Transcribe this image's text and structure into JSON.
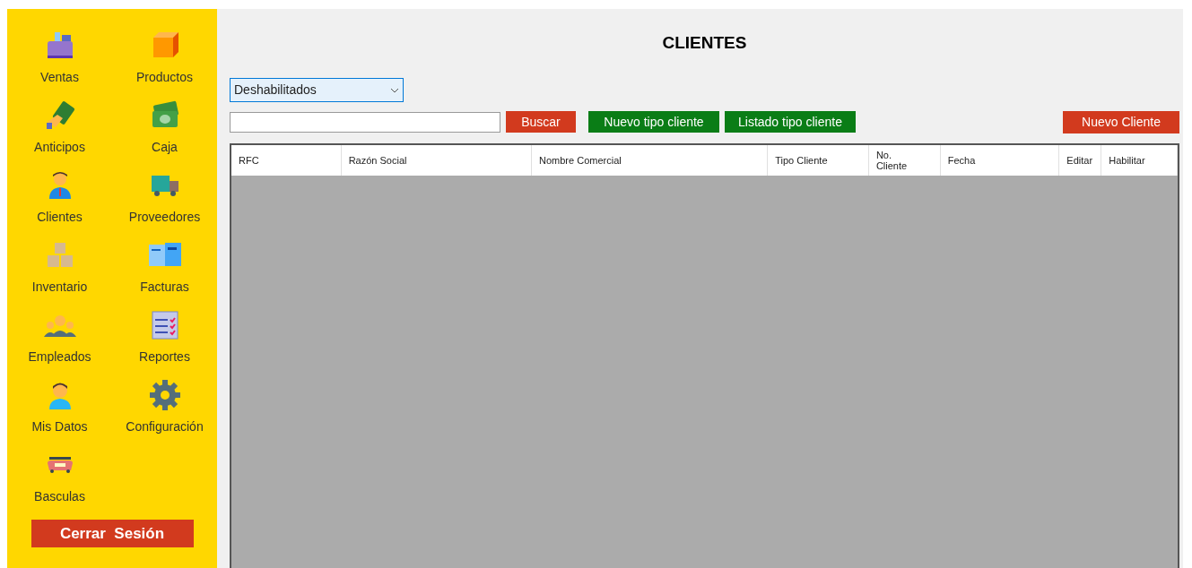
{
  "sidebar": {
    "items": [
      {
        "label": "Ventas"
      },
      {
        "label": "Productos"
      },
      {
        "label": "Anticipos"
      },
      {
        "label": "Caja"
      },
      {
        "label": "Clientes"
      },
      {
        "label": "Proveedores"
      },
      {
        "label": "Inventario"
      },
      {
        "label": "Facturas"
      },
      {
        "label": "Empleados"
      },
      {
        "label": "Reportes"
      },
      {
        "label": "Mis Datos"
      },
      {
        "label": "Configuración"
      },
      {
        "label": "Basculas"
      }
    ],
    "logout_button": "Cerrar  Sesión"
  },
  "title": "CLIENTES",
  "filter": {
    "value": "Deshabilitados"
  },
  "search": {
    "button": "Buscar"
  },
  "buttons": [
    {
      "label": "Nuevo tipo cliente"
    },
    {
      "label": "Listado tipo cliente"
    }
  ],
  "new_button": "Nuevo Cliente",
  "table": {
    "columns": [
      "RFC",
      "Razón Social",
      "Nombre Comercial",
      "Tipo Cliente",
      "No. Cliente",
      "Fecha",
      "Editar",
      "Habilitar"
    ]
  }
}
